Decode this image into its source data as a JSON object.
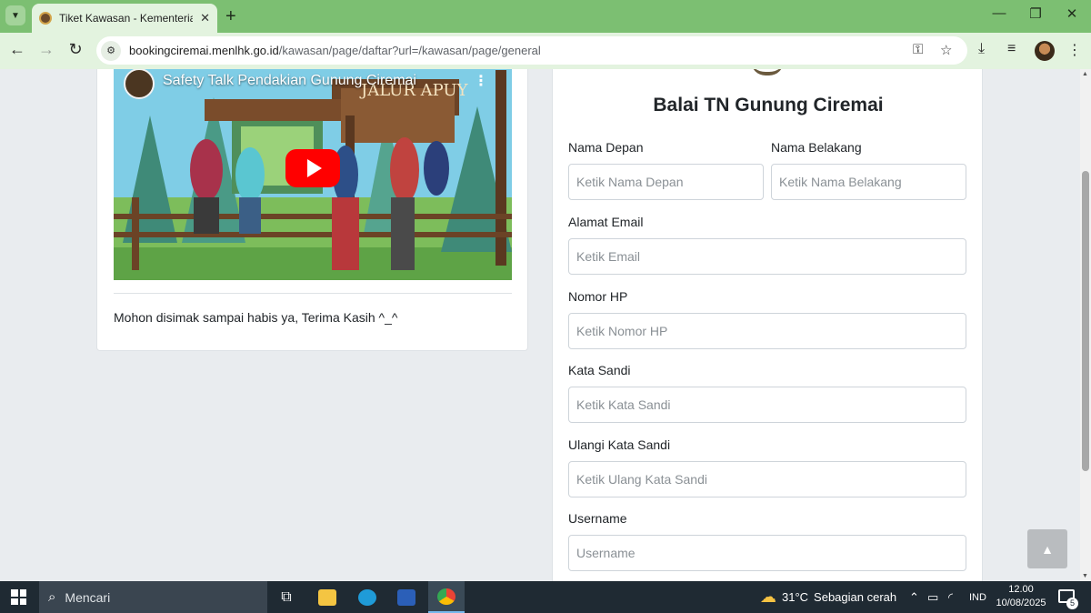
{
  "browser": {
    "tab_title": "Tiket Kawasan - Kementerian Li",
    "url_host": "bookingciremai.menlhk.go.id",
    "url_path": "/kawasan/page/daftar?url=/kawasan/page/general"
  },
  "video": {
    "title": "Safety Talk Pendakian Gunung Ciremai",
    "sign_text": "JALUR APUY",
    "caption": "Mohon disimak sampai habis ya, Terima Kasih ^_^"
  },
  "form": {
    "title": "Balai TN Gunung Ciremai",
    "fields": [
      {
        "label": "Nama Depan",
        "placeholder": "Ketik Nama Depan"
      },
      {
        "label": "Nama Belakang",
        "placeholder": "Ketik Nama Belakang"
      },
      {
        "label": "Alamat Email",
        "placeholder": "Ketik Email"
      },
      {
        "label": "Nomor HP",
        "placeholder": "Ketik Nomor HP"
      },
      {
        "label": "Kata Sandi",
        "placeholder": "Ketik Kata Sandi"
      },
      {
        "label": "Ulangi Kata Sandi",
        "placeholder": "Ketik Ulang Kata Sandi"
      },
      {
        "label": "Username",
        "placeholder": "Username"
      }
    ]
  },
  "taskbar": {
    "search_label": "Mencari",
    "weather_temp": "31°C",
    "weather_desc": "Sebagian cerah",
    "language": "IND",
    "time": "12.00",
    "date": "10/08/2025",
    "notification_count": "5"
  },
  "colors": {
    "titlebar": "#7cbf72",
    "toolbar": "#e3f3df",
    "taskbar": "#1f2a33",
    "play": "#ff0000"
  }
}
